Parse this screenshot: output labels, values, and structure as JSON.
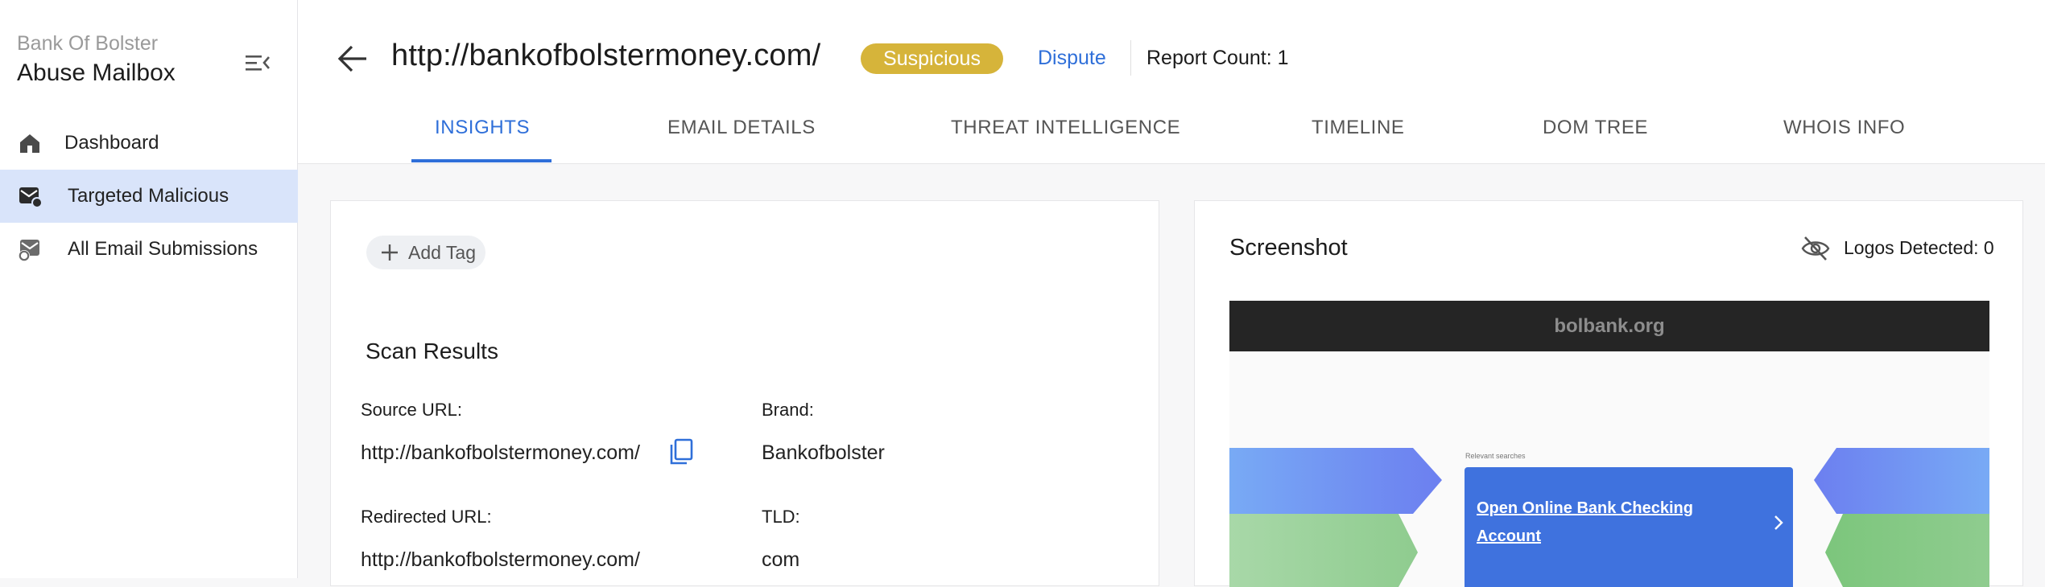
{
  "sidebar": {
    "brand_sub": "Bank Of Bolster",
    "brand_main": "Abuse Mailbox",
    "items": [
      {
        "label": "Dashboard",
        "icon": "home-icon"
      },
      {
        "label": "Targeted Malicious",
        "icon": "mail-alert-icon",
        "active": true
      },
      {
        "label": "All Email Submissions",
        "icon": "mail-submission-icon"
      }
    ]
  },
  "header": {
    "url": "http://bankofbolstermoney.com/",
    "status": "Suspicious",
    "dispute": "Dispute",
    "report_count": "Report Count: 1",
    "tabs": [
      {
        "label": "INSIGHTS",
        "active": true
      },
      {
        "label": "EMAIL DETAILS"
      },
      {
        "label": "THREAT INTELLIGENCE"
      },
      {
        "label": "TIMELINE"
      },
      {
        "label": "DOM TREE"
      },
      {
        "label": "WHOIS INFO"
      }
    ]
  },
  "scan": {
    "add_tag": "Add Tag",
    "title": "Scan Results",
    "source_url_label": "Source URL:",
    "source_url": "http://bankofbolstermoney.com/",
    "brand_label": "Brand:",
    "brand": "Bankofbolster",
    "redirected_url_label": "Redirected URL:",
    "redirected_url": "http://bankofbolstermoney.com/",
    "tld_label": "TLD:",
    "tld": "com"
  },
  "screenshot": {
    "title": "Screenshot",
    "logos_detected": "Logos Detected: 0",
    "preview_domain": "bolbank.org",
    "relevant_searches": "Relevant searches",
    "promo_text": "Open Online Bank Checking Account"
  },
  "colors": {
    "accent": "#2f6fd9",
    "status_suspicious": "#d6b43a",
    "active_nav_bg": "#d9e4fa",
    "promo_card": "#3f72de"
  }
}
